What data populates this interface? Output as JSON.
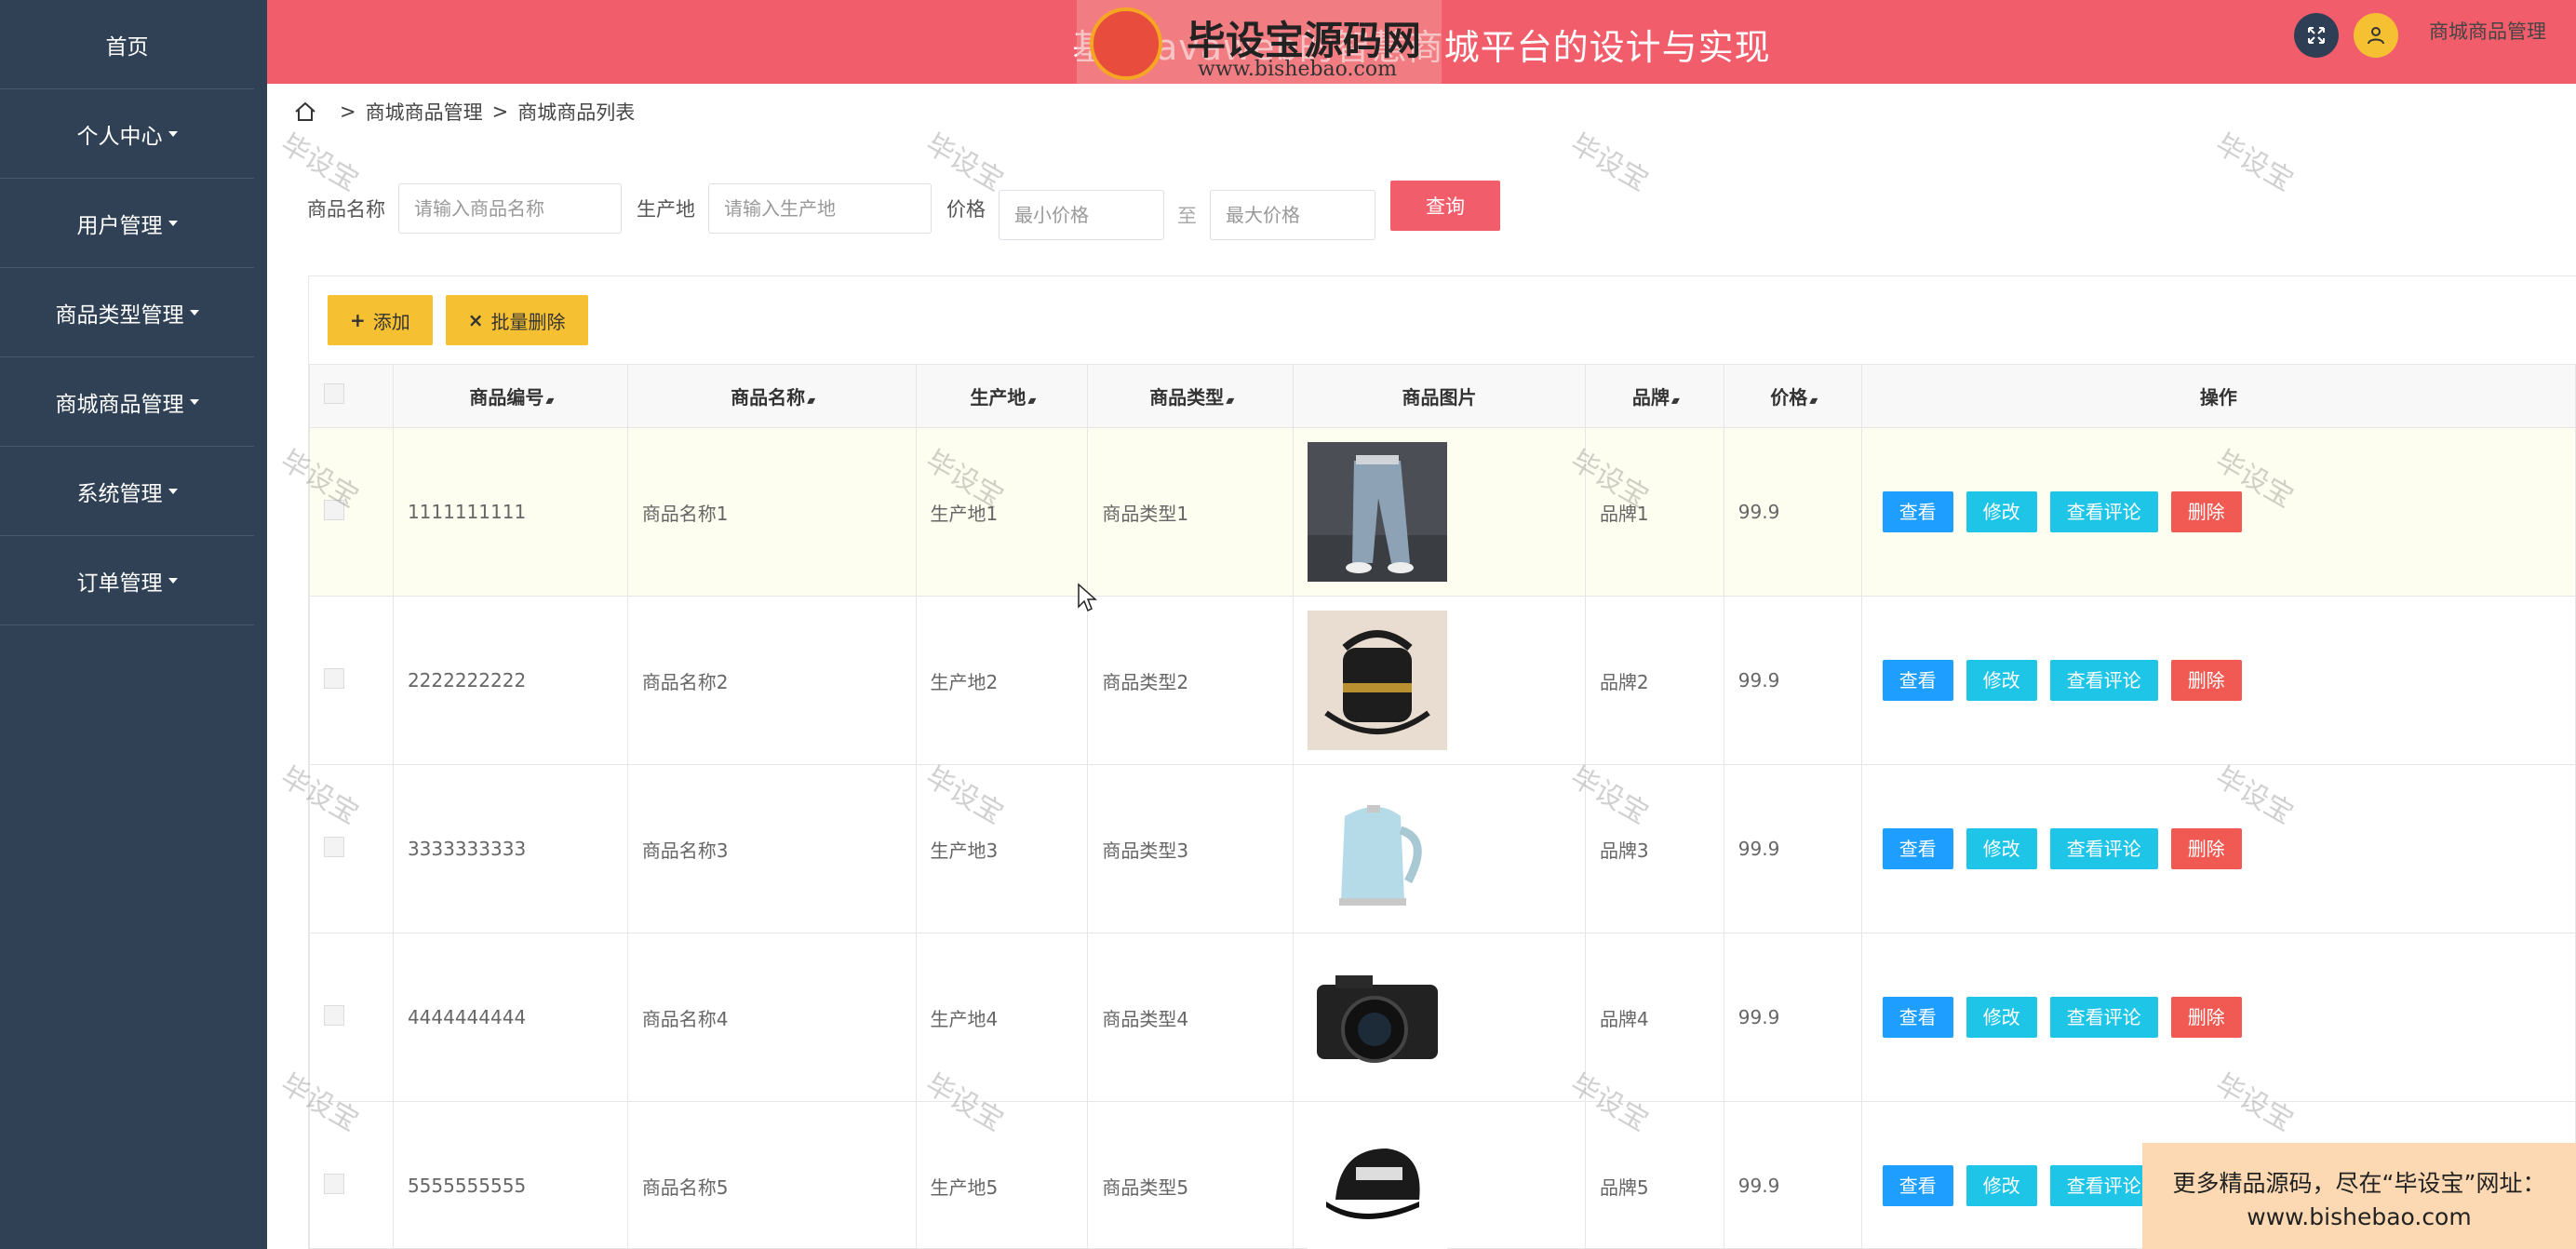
{
  "sidebar": {
    "items": [
      {
        "label": "首页",
        "dropdown": false
      },
      {
        "label": "个人中心",
        "dropdown": true
      },
      {
        "label": "用户管理",
        "dropdown": true
      },
      {
        "label": "商品类型管理",
        "dropdown": true
      },
      {
        "label": "商城商品管理",
        "dropdown": true
      },
      {
        "label": "系统管理",
        "dropdown": true
      },
      {
        "label": "订单管理",
        "dropdown": true
      }
    ]
  },
  "header": {
    "title": "基于javaweb的智慧商城平台的设计与实现",
    "accent": "#f25d6b"
  },
  "watermark": {
    "logo_name": "毕设宝源码网",
    "logo_url": "www.bishebao.com",
    "text": "毕设宝"
  },
  "breadcrumb": {
    "level1": "商城商品管理",
    "level2": "商城商品列表",
    "right": "商城商品管理"
  },
  "search": {
    "name_label": "商品名称",
    "name_placeholder": "请输入商品名称",
    "origin_label": "生产地",
    "origin_placeholder": "请输入生产地",
    "price_label": "价格",
    "min_placeholder": "最小价格",
    "to_label": "至",
    "max_placeholder": "最大价格",
    "query_button": "查询"
  },
  "toolbar": {
    "add_label": "添加",
    "batch_delete_label": "批量删除"
  },
  "table": {
    "columns": [
      "商品编号",
      "商品名称",
      "生产地",
      "商品类型",
      "商品图片",
      "品牌",
      "价格",
      "操作"
    ],
    "rows": [
      {
        "code": "1111111111",
        "name": "商品名称1",
        "origin": "生产地1",
        "type": "商品类型1",
        "image": "pants",
        "brand": "品牌1",
        "price": "99.9"
      },
      {
        "code": "2222222222",
        "name": "商品名称2",
        "origin": "生产地2",
        "type": "商品类型2",
        "image": "bag",
        "brand": "品牌2",
        "price": "99.9"
      },
      {
        "code": "3333333333",
        "name": "商品名称3",
        "origin": "生产地3",
        "type": "商品类型3",
        "image": "kettle",
        "brand": "品牌3",
        "price": "99.9"
      },
      {
        "code": "4444444444",
        "name": "商品名称4",
        "origin": "生产地4",
        "type": "商品类型4",
        "image": "camera",
        "brand": "品牌4",
        "price": "99.9"
      },
      {
        "code": "5555555555",
        "name": "商品名称5",
        "origin": "生产地5",
        "type": "商品类型5",
        "image": "cap",
        "brand": "品牌5",
        "price": "99.9"
      }
    ],
    "actions": {
      "view": "查看",
      "edit": "修改",
      "comments": "查看评论",
      "delete": "删除"
    }
  },
  "ad": {
    "line1": "更多精品源码，尽在“毕设宝”网址：",
    "line2": "www.bishebao.com"
  }
}
